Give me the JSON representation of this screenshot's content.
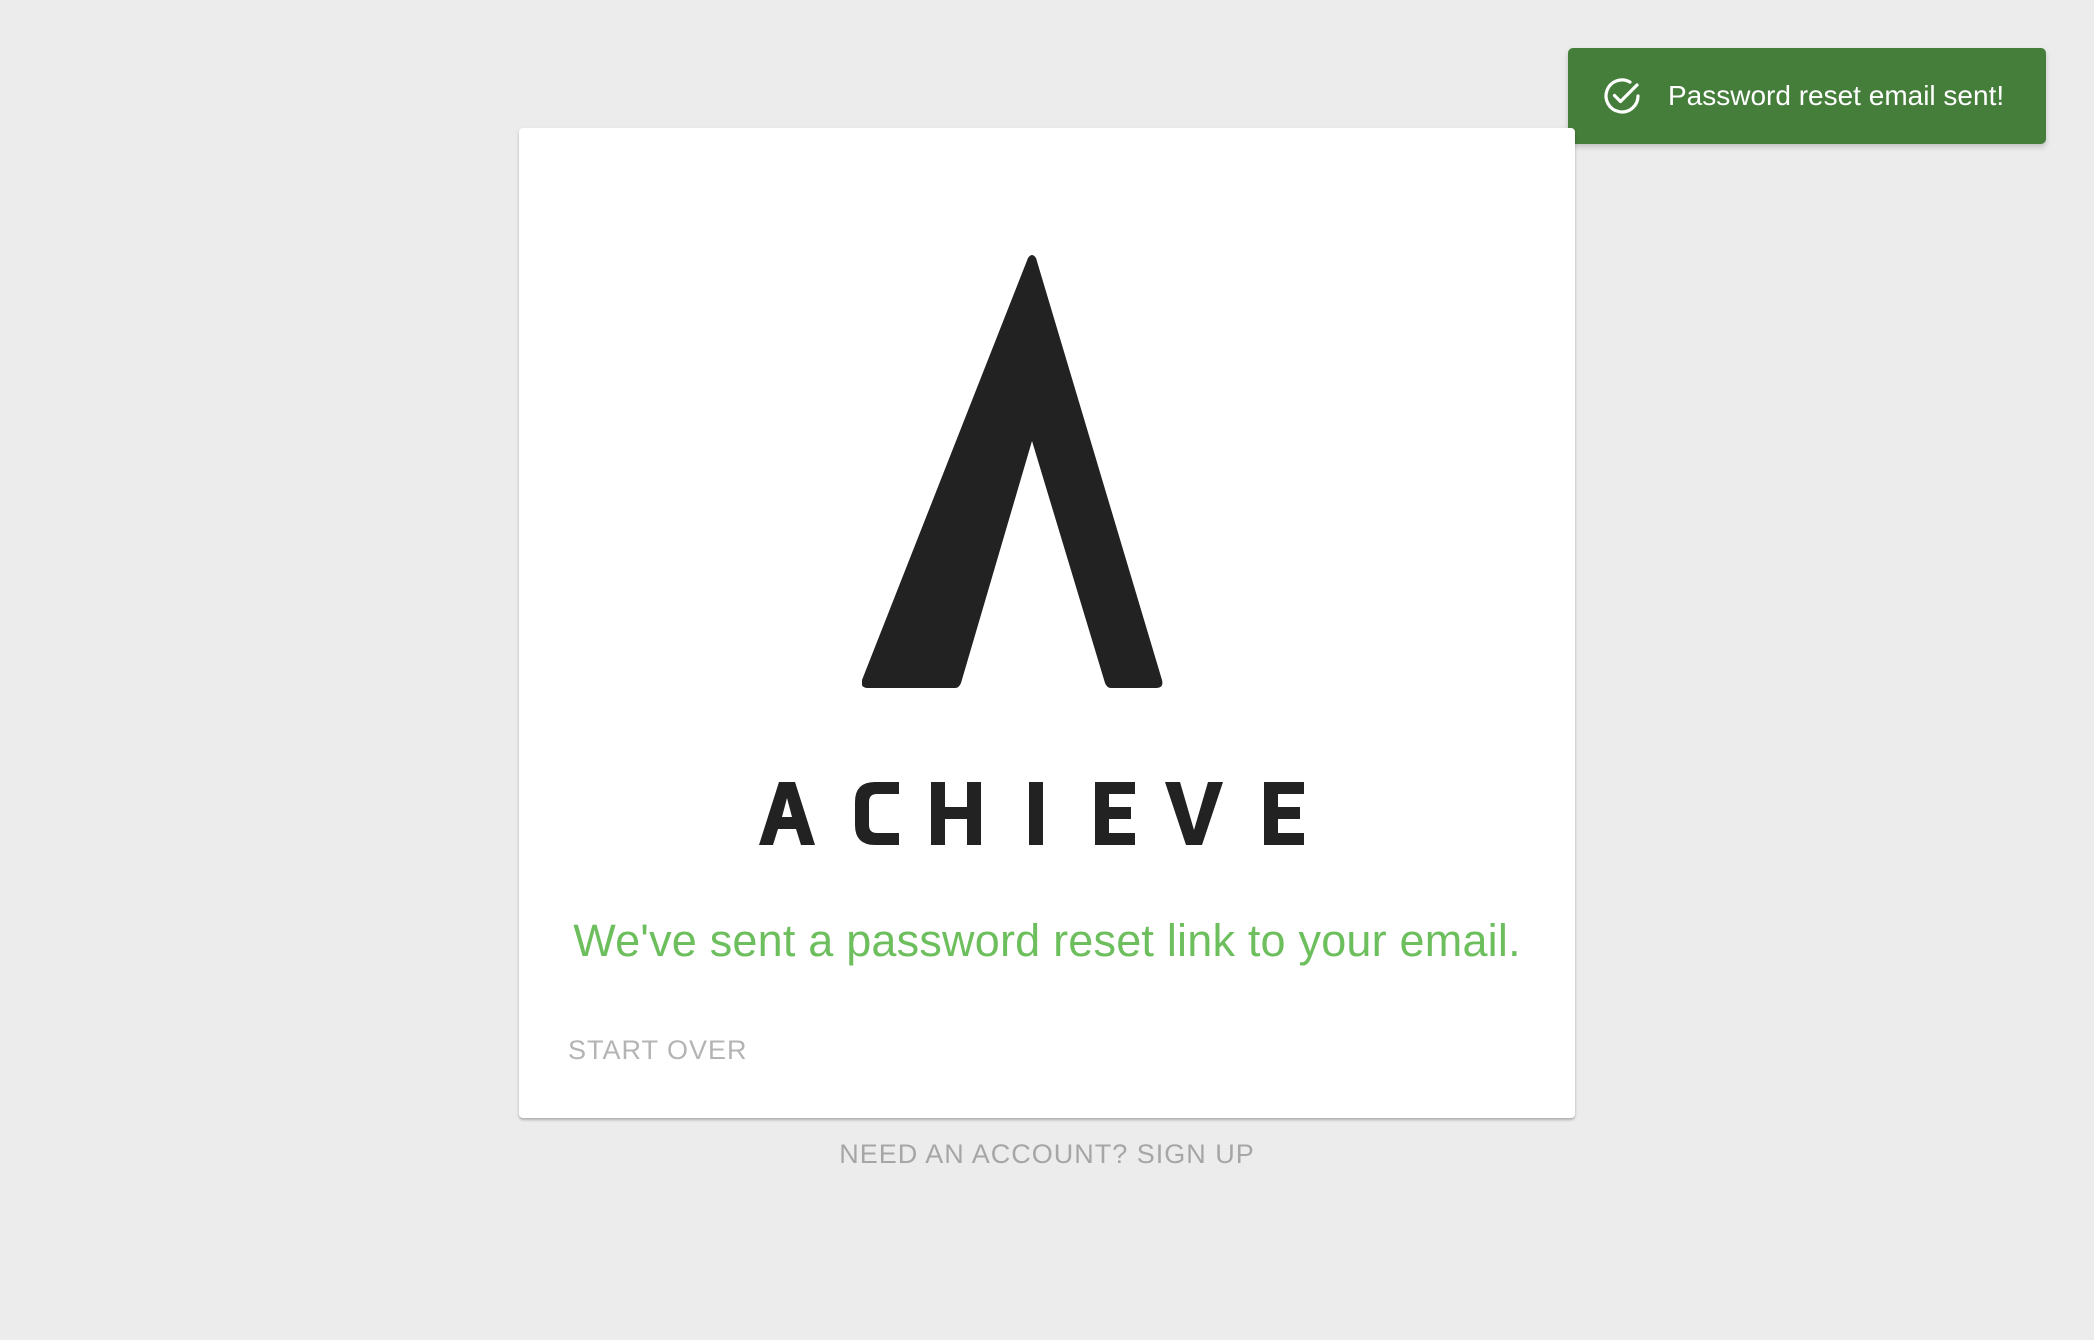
{
  "toast": {
    "message": "Password reset email sent!",
    "icon": "check-circle-icon",
    "background": "#457e3b"
  },
  "brand": {
    "wordmark": "ACHIEVE",
    "logo_color": "#222222"
  },
  "card": {
    "message": "We've sent a password reset link to your email.",
    "message_color": "#6dbf5e",
    "start_over_label": "START OVER"
  },
  "footer": {
    "signup_label": "NEED AN ACCOUNT? SIGN UP"
  }
}
